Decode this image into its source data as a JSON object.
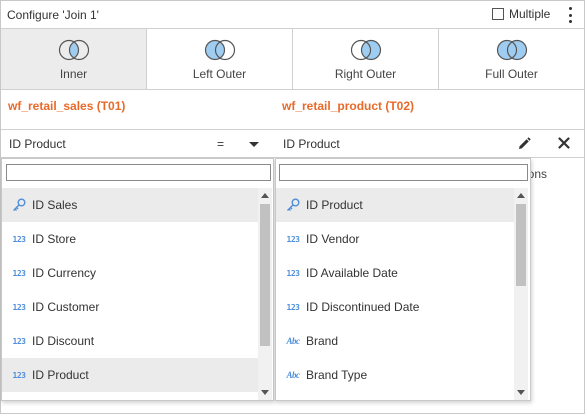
{
  "header": {
    "title": "Configure 'Join 1'",
    "multiple_label": "Multiple",
    "multiple_checked": false
  },
  "join_types": [
    {
      "label": "Inner",
      "selected": true,
      "icon": "inner-join-icon"
    },
    {
      "label": "Left Outer",
      "selected": false,
      "icon": "left-outer-join-icon"
    },
    {
      "label": "Right Outer",
      "selected": false,
      "icon": "right-outer-join-icon"
    },
    {
      "label": "Full Outer",
      "selected": false,
      "icon": "full-outer-join-icon"
    }
  ],
  "tables": {
    "left": "wf_retail_sales (T01)",
    "right": "wf_retail_product (T02)"
  },
  "condition": {
    "left_field": "ID Product",
    "operator": "=",
    "right_field": "ID Product",
    "edit_icon": "pencil-icon",
    "remove_icon": "close-icon"
  },
  "background_text": "ions",
  "left_dropdown": {
    "search_value": "",
    "items": [
      {
        "label": "ID Sales",
        "icon": "key-icon",
        "highlighted": true
      },
      {
        "label": "ID Store",
        "icon": "numeric-icon",
        "highlighted": false
      },
      {
        "label": "ID Currency",
        "icon": "numeric-icon",
        "highlighted": false
      },
      {
        "label": "ID Customer",
        "icon": "numeric-icon",
        "highlighted": false
      },
      {
        "label": "ID Discount",
        "icon": "numeric-icon",
        "highlighted": false
      },
      {
        "label": "ID Product",
        "icon": "numeric-icon",
        "highlighted": true
      }
    ]
  },
  "right_dropdown": {
    "search_value": "",
    "items": [
      {
        "label": "ID Product",
        "icon": "key-icon",
        "highlighted": true
      },
      {
        "label": "ID Vendor",
        "icon": "numeric-icon",
        "highlighted": false
      },
      {
        "label": "ID Available Date",
        "icon": "numeric-icon",
        "highlighted": false
      },
      {
        "label": "ID Discontinued Date",
        "icon": "numeric-icon",
        "highlighted": false
      },
      {
        "label": "Brand",
        "icon": "text-icon",
        "highlighted": false
      },
      {
        "label": "Brand Type",
        "icon": "text-icon",
        "highlighted": false
      }
    ]
  },
  "icon_glyphs": {
    "numeric": "123",
    "text": "Abc"
  },
  "colors": {
    "accent_orange": "#e86a2a",
    "icon_blue": "#4f8fd9",
    "venn_fill": "#9fcdf2",
    "selected_bg": "#ececec"
  }
}
